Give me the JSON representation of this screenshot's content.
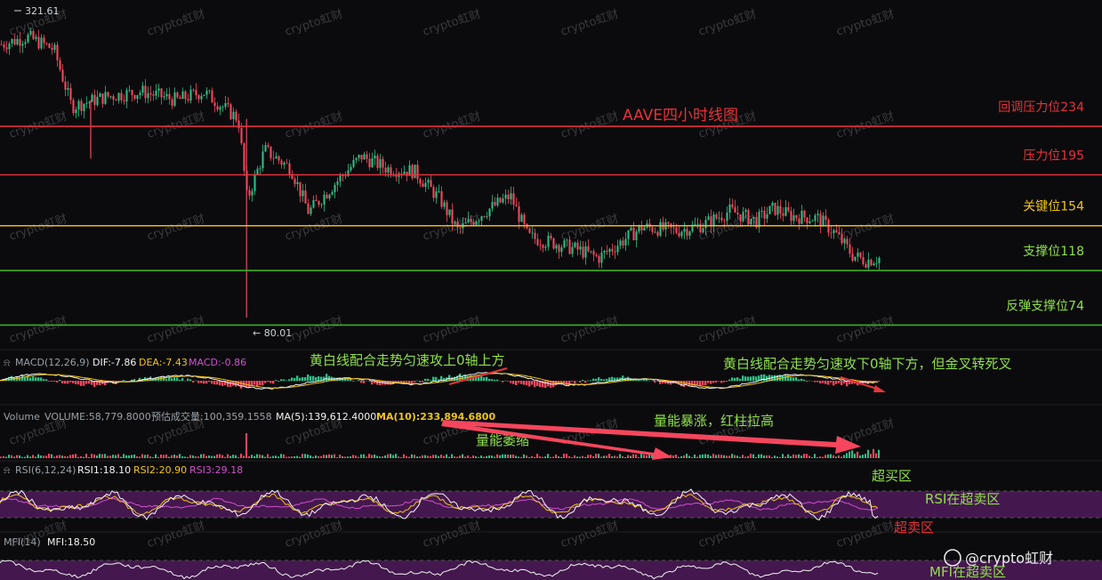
{
  "colors": {
    "background": "#0b0b0d",
    "up": "#2ebd85",
    "down": "#f6465d",
    "resistance_line": "#e2323c",
    "key_line": "#f0b90b",
    "support_line": "#37b21f",
    "annotation_red": "#e5333b",
    "annotation_yellow": "#f0c419",
    "annotation_green": "#8fe04a",
    "overbought_band": "#4a1a55",
    "dif": "#f3f3f3",
    "dea": "#f0c419",
    "rsi1": "#f3f3f3",
    "rsi2": "#f0c419",
    "rsi3": "#d24fd0"
  },
  "chart_data": {
    "type": "candlestick",
    "title": "AAVE四小时线图",
    "price_high_label": "321.61",
    "price_low_label": "← 80.01",
    "close_path": [
      [
        0,
        300
      ],
      [
        0.03,
        306
      ],
      [
        0.06,
        296
      ],
      [
        0.08,
        250
      ],
      [
        0.12,
        258
      ],
      [
        0.16,
        262
      ],
      [
        0.2,
        255
      ],
      [
        0.23,
        262
      ],
      [
        0.27,
        240
      ],
      [
        0.28,
        175
      ],
      [
        0.3,
        215
      ],
      [
        0.33,
        200
      ],
      [
        0.35,
        165
      ],
      [
        0.38,
        188
      ],
      [
        0.41,
        210
      ],
      [
        0.44,
        200
      ],
      [
        0.47,
        198
      ],
      [
        0.5,
        175
      ],
      [
        0.52,
        150
      ],
      [
        0.55,
        165
      ],
      [
        0.58,
        178
      ],
      [
        0.6,
        145
      ],
      [
        0.63,
        140
      ],
      [
        0.66,
        134
      ],
      [
        0.68,
        128
      ],
      [
        0.7,
        138
      ],
      [
        0.73,
        153
      ],
      [
        0.77,
        150
      ],
      [
        0.8,
        155
      ],
      [
        0.83,
        166
      ],
      [
        0.86,
        158
      ],
      [
        0.88,
        168
      ],
      [
        0.9,
        162
      ],
      [
        0.93,
        160
      ],
      [
        0.95,
        148
      ],
      [
        0.97,
        130
      ],
      [
        0.985,
        126
      ],
      [
        1,
        128
      ]
    ],
    "levels": [
      {
        "label": "回调压力位234",
        "value": 234,
        "role": "resistance"
      },
      {
        "label": "压力位195",
        "value": 195,
        "role": "resistance"
      },
      {
        "label": "关键位154",
        "value": 154,
        "role": "key"
      },
      {
        "label": "支撑位118",
        "value": 118,
        "role": "support"
      },
      {
        "label": "反弹支撑位74",
        "value": 74,
        "role": "support"
      }
    ],
    "price_scale": [
      60,
      330
    ]
  },
  "indicators": {
    "macd": {
      "title": "MACD(12,26,9)",
      "dif": "DIF:-7.86",
      "dea": "DEA:-7.43",
      "macd": "MACD:-0.86",
      "note_left": "黄白线配合走势匀速攻上0轴上方",
      "note_right": "黄白线配合走势匀速攻下0轴下方，但金叉转死叉"
    },
    "volume": {
      "title": "Volume",
      "volume": "VOLUME:58,779.8000",
      "forecast": "预估成交量:100,359.1558",
      "ma5": "MA(5):139,612.4000",
      "ma10": "MA(10):233,894.6800",
      "note_shrink": "量能萎缩",
      "note_surge": "量能暴涨，红柱拉高"
    },
    "rsi": {
      "title": "RSI(6,12,24)",
      "rsi1": "RSI1:18.10",
      "rsi2": "RSI2:20.90",
      "rsi3": "RSI3:29.18",
      "note_overbought": "超买区",
      "note_oversold_rsi": "RSI在超卖区",
      "note_oversold": "超卖区"
    },
    "mfi": {
      "title": "MFI(14)",
      "mfi": "MFI:18.50",
      "note": "MFI在超卖区"
    }
  },
  "watermark": "crypto虹财",
  "brand": "@crypto虹财"
}
